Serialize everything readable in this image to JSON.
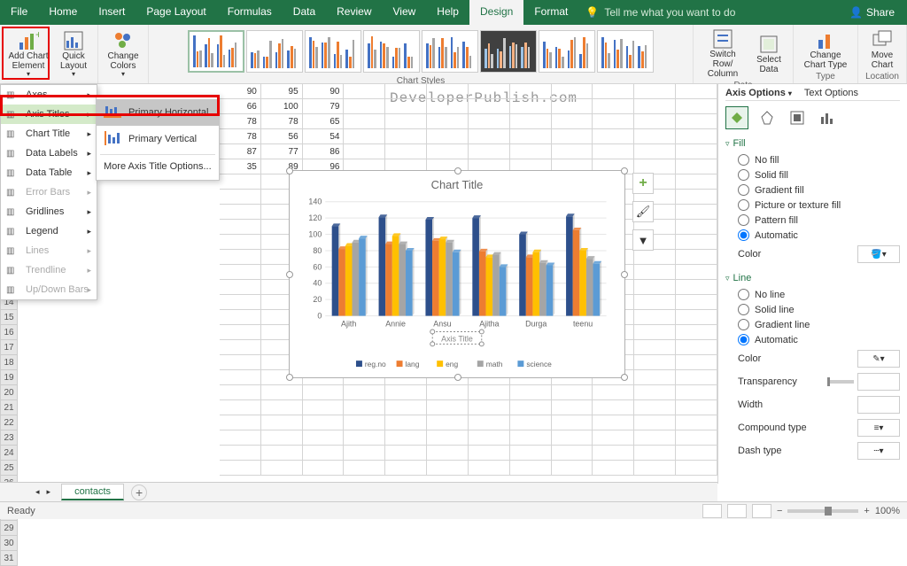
{
  "titlebar": {
    "tabs": [
      "File",
      "Home",
      "Insert",
      "Page Layout",
      "Formulas",
      "Data",
      "Review",
      "View",
      "Help",
      "Design",
      "Format"
    ],
    "active_tab": "Design",
    "tell_me": "Tell me what you want to do",
    "share": "Share"
  },
  "ribbon": {
    "add_chart_element": "Add Chart Element",
    "quick_layout": "Quick Layout",
    "change_colors": "Change Colors",
    "chart_styles_label": "Chart Styles",
    "switch_row_col": "Switch Row/ Column",
    "select_data": "Select Data",
    "data_label": "Data",
    "change_chart_type": "Change Chart Type",
    "type_label": "Type",
    "move_chart": "Move Chart",
    "location_label": "Location"
  },
  "add_chart_menu": {
    "items": [
      {
        "label": "Axes",
        "enabled": true
      },
      {
        "label": "Axis Titles",
        "enabled": true,
        "highlighted": true
      },
      {
        "label": "Chart Title",
        "enabled": true
      },
      {
        "label": "Data Labels",
        "enabled": true
      },
      {
        "label": "Data Table",
        "enabled": true
      },
      {
        "label": "Error Bars",
        "enabled": false
      },
      {
        "label": "Gridlines",
        "enabled": true
      },
      {
        "label": "Legend",
        "enabled": true
      },
      {
        "label": "Lines",
        "enabled": false
      },
      {
        "label": "Trendline",
        "enabled": false
      },
      {
        "label": "Up/Down Bars",
        "enabled": false
      }
    ]
  },
  "axis_submenu": {
    "primary_h": "Primary Horizontal",
    "primary_v": "Primary Vertical",
    "more": "More Axis Title Options..."
  },
  "grid": {
    "first_row_num": 14,
    "data_rows": [
      [
        90,
        95,
        90
      ],
      [
        66,
        100,
        79
      ],
      [
        78,
        78,
        65
      ],
      [
        78,
        56,
        54
      ],
      [
        87,
        77,
        86
      ],
      [
        35,
        89,
        96
      ]
    ],
    "empty_rows": 20
  },
  "chart_data": {
    "type": "bar",
    "title": "Chart Title",
    "axis_title_placeholder": "Axis Title",
    "categories": [
      "Ajith",
      "Annie",
      "Ansu",
      "Ajitha",
      "Durga",
      "teenu"
    ],
    "series": [
      {
        "name": "reg.no",
        "color": "#2d4f8b",
        "values": [
          110,
          121,
          118,
          120,
          100,
          122
        ]
      },
      {
        "name": "lang",
        "color": "#ed7d31",
        "values": [
          82,
          88,
          92,
          79,
          72,
          105
        ]
      },
      {
        "name": "eng",
        "color": "#ffc000",
        "values": [
          86,
          98,
          94,
          72,
          78,
          80
        ]
      },
      {
        "name": "math",
        "color": "#a5a5a5",
        "values": [
          90,
          88,
          90,
          75,
          65,
          70
        ]
      },
      {
        "name": "science",
        "color": "#5b9bd5",
        "values": [
          95,
          80,
          78,
          60,
          62,
          64
        ]
      }
    ],
    "ylim": [
      0,
      140
    ],
    "yticks": [
      0,
      20,
      40,
      60,
      80,
      100,
      120,
      140
    ]
  },
  "side_buttons": {
    "plus": "+",
    "brush": "🖌",
    "funnel": "⧩"
  },
  "format_pane": {
    "header_active": "Axis Options",
    "header_inactive": "Text Options",
    "fill": {
      "header": "Fill",
      "options": [
        "No fill",
        "Solid fill",
        "Gradient fill",
        "Picture or texture fill",
        "Pattern fill",
        "Automatic"
      ],
      "selected": "Automatic",
      "color_label": "Color"
    },
    "line": {
      "header": "Line",
      "options": [
        "No line",
        "Solid line",
        "Gradient line",
        "Automatic"
      ],
      "selected": "Automatic",
      "color_label": "Color",
      "transparency_label": "Transparency",
      "width_label": "Width",
      "compound_label": "Compound type",
      "dash_label": "Dash type"
    }
  },
  "sheet_tabs": {
    "active": "contacts"
  },
  "statusbar": {
    "ready": "Ready",
    "zoom": "100%"
  },
  "watermark": "DeveloperPublish.com"
}
